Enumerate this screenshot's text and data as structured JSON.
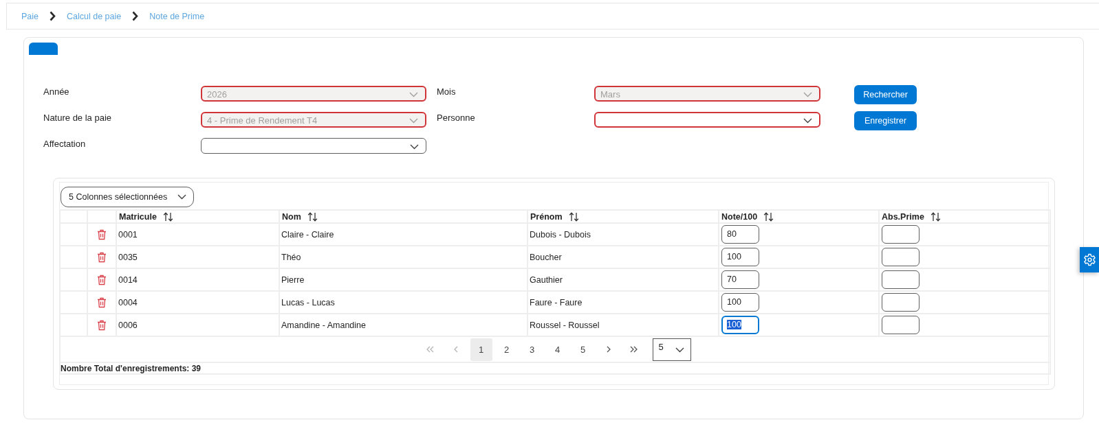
{
  "breadcrumb": [
    {
      "label": "Paie"
    },
    {
      "label": "Calcul de paie"
    },
    {
      "label": "Note de Prime"
    }
  ],
  "tabs": [
    {
      "selected": true
    }
  ],
  "filter_rows": [
    {
      "fields": [
        {
          "label": "Année",
          "value": "2026",
          "disabled": true,
          "invalid": true
        },
        {
          "label": "Mois",
          "value": "Mars",
          "disabled": true,
          "invalid": true
        }
      ],
      "button": "Rechercher"
    },
    {
      "fields": [
        {
          "label": "Nature de la paie",
          "value": "4 - Prime de Rendement T4",
          "disabled": true,
          "invalid": true
        },
        {
          "label": "Personne",
          "disabled": false,
          "invalid": true
        }
      ],
      "button": "Enregistrer"
    },
    {
      "fields": [
        {
          "label": "Affectation",
          "disabled": false,
          "invalid": false
        }
      ]
    }
  ],
  "table": {
    "column_picker": "5 Colonnes sélectionnées",
    "columns": [
      "Matricule",
      "Nom",
      "Prénom",
      "Note/100",
      "Abs.Prime"
    ],
    "rows": [
      {
        "matricule": "0001",
        "nom": "Claire - Claire",
        "prenom": "Dubois - Dubois",
        "note": "80",
        "note_focused": false
      },
      {
        "matricule": "0035",
        "nom": "Théo",
        "prenom": "Boucher",
        "note": "100",
        "note_focused": false
      },
      {
        "matricule": "0014",
        "nom": "Pierre",
        "prenom": "Gauthier",
        "note": "70",
        "note_focused": false
      },
      {
        "matricule": "0004",
        "nom": "Lucas - Lucas",
        "prenom": "Faure - Faure",
        "note": "100",
        "note_focused": false
      },
      {
        "matricule": "0006",
        "nom": "Amandine - Amandine",
        "prenom": "Roussel - Roussel",
        "note": "100",
        "note_focused": true
      }
    ],
    "pagination": {
      "first": {
        "disabled": true
      },
      "previous": {
        "disabled": true
      },
      "pages": [
        {
          "label": "1",
          "selected": true
        },
        {
          "label": "2",
          "selected": false
        },
        {
          "label": "3",
          "selected": false
        },
        {
          "label": "4",
          "selected": false
        },
        {
          "label": "5",
          "selected": false
        }
      ],
      "next": {
        "disabled": false
      },
      "last": {
        "disabled": false
      },
      "page_size": "5"
    },
    "total": "Nombre Total d'enregistrements: 39"
  }
}
